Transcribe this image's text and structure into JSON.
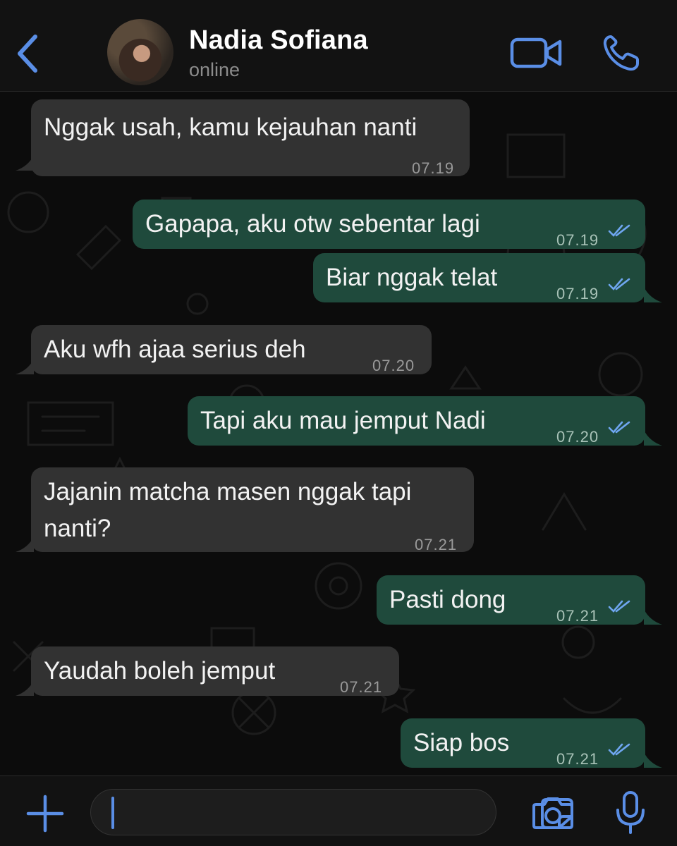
{
  "header": {
    "name": "Nadia Sofiana",
    "status": "online",
    "back_icon": "chevron-left-icon",
    "video_icon": "video-camera-icon",
    "call_icon": "phone-icon"
  },
  "messages": [
    {
      "direction": "incoming",
      "text": "Nggak usah, kamu kejauhan nanti",
      "time": "07.19"
    },
    {
      "direction": "outgoing",
      "text": "Gapapa, aku otw sebentar lagi",
      "time": "07.19",
      "read": true
    },
    {
      "direction": "outgoing",
      "text": "Biar nggak telat",
      "time": "07.19",
      "read": true
    },
    {
      "direction": "incoming",
      "text": "Aku wfh ajaa serius deh",
      "time": "07.20"
    },
    {
      "direction": "outgoing",
      "text": "Tapi aku mau jemput Nadi",
      "time": "07.20",
      "read": true
    },
    {
      "direction": "incoming",
      "text": "Jajanin matcha masen nggak tapi nanti?",
      "time": "07.21"
    },
    {
      "direction": "outgoing",
      "text": "Pasti dong",
      "time": "07.21",
      "read": true
    },
    {
      "direction": "incoming",
      "text": "Yaudah boleh jemput",
      "time": "07.21"
    },
    {
      "direction": "outgoing",
      "text": "Siap bos",
      "time": "07.21",
      "read": true
    }
  ],
  "input": {
    "value": "",
    "plus_icon": "plus-icon",
    "sticker_icon": "sticker-icon",
    "camera_icon": "camera-icon",
    "mic_icon": "microphone-icon"
  },
  "colors": {
    "accent": "#5a8ee6",
    "incoming_bubble": "#323232",
    "outgoing_bubble": "#1f4a3c",
    "read_ticks": "#6fa6f0"
  }
}
